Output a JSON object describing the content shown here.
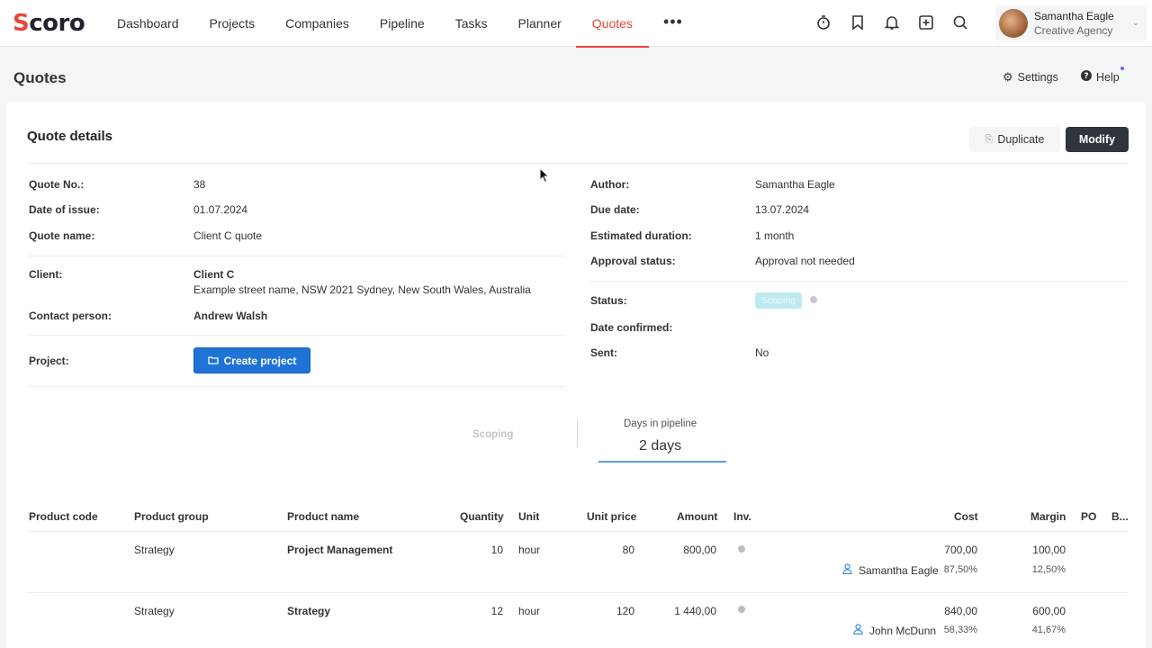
{
  "app": {
    "logo": "Scoro",
    "nav": [
      "Dashboard",
      "Projects",
      "Companies",
      "Pipeline",
      "Tasks",
      "Planner",
      "Quotes"
    ],
    "nav_more": "•••",
    "active_nav": "Quotes",
    "accent_color": "#e8483b",
    "top_icons": [
      "timer-icon",
      "bookmark-icon",
      "bell-icon",
      "add-icon",
      "search-icon"
    ],
    "user": {
      "name": "Samantha Eagle",
      "org": "Creative Agency"
    }
  },
  "page": {
    "title": "Quotes",
    "settings_label": "Settings",
    "help_label": "Help"
  },
  "quote": {
    "section_title": "Quote details",
    "duplicate_label": "Duplicate",
    "modify_label": "Modify",
    "left": {
      "quote_no_label": "Quote No.:",
      "quote_no": "38",
      "date_issue_label": "Date of issue:",
      "date_issue": "01.07.2024",
      "quote_name_label": "Quote name:",
      "quote_name": "Client C quote",
      "client_label": "Client:",
      "client": "Client C",
      "client_address": "Example street name, NSW 2021 Sydney, New South Wales, Australia",
      "contact_label": "Contact person:",
      "contact": "Andrew Walsh",
      "project_label": "Project:",
      "create_project_label": "Create project"
    },
    "right": {
      "author_label": "Author:",
      "author": "Samantha Eagle",
      "due_label": "Due date:",
      "due": "13.07.2024",
      "duration_label": "Estimated duration:",
      "duration": "1 month",
      "approval_label": "Approval status:",
      "approval": "Approval not needed",
      "status_label": "Status:",
      "status": "Scoping",
      "confirmed_label": "Date confirmed:",
      "sent_label": "Sent:",
      "sent": "No"
    },
    "pipeline": {
      "stage": "Scoping",
      "days_label": "Days in pipeline",
      "days_value": "2 days"
    }
  },
  "table": {
    "headers": {
      "code": "Product code",
      "group": "Product group",
      "name": "Product name",
      "qty": "Quantity",
      "unit": "Unit",
      "price": "Unit price",
      "amount": "Amount",
      "inv": "Inv.",
      "cost": "Cost",
      "margin": "Margin",
      "po": "PO",
      "b": "B..."
    },
    "rows": [
      {
        "group": "Strategy",
        "name": "Project Management",
        "qty": "10",
        "unit": "hour",
        "price": "80",
        "amount": "800,00",
        "cost": "700,00",
        "margin": "100,00",
        "person": "Samantha Eagle",
        "cost_pct": "87,50%",
        "margin_pct": "12,50%"
      },
      {
        "group": "Strategy",
        "name": "Strategy",
        "qty": "12",
        "unit": "hour",
        "price": "120",
        "amount": "1 440,00",
        "cost": "840,00",
        "margin": "600,00",
        "person": "John McDunn",
        "cost_pct": "58,33%",
        "margin_pct": "41,67%"
      }
    ]
  }
}
